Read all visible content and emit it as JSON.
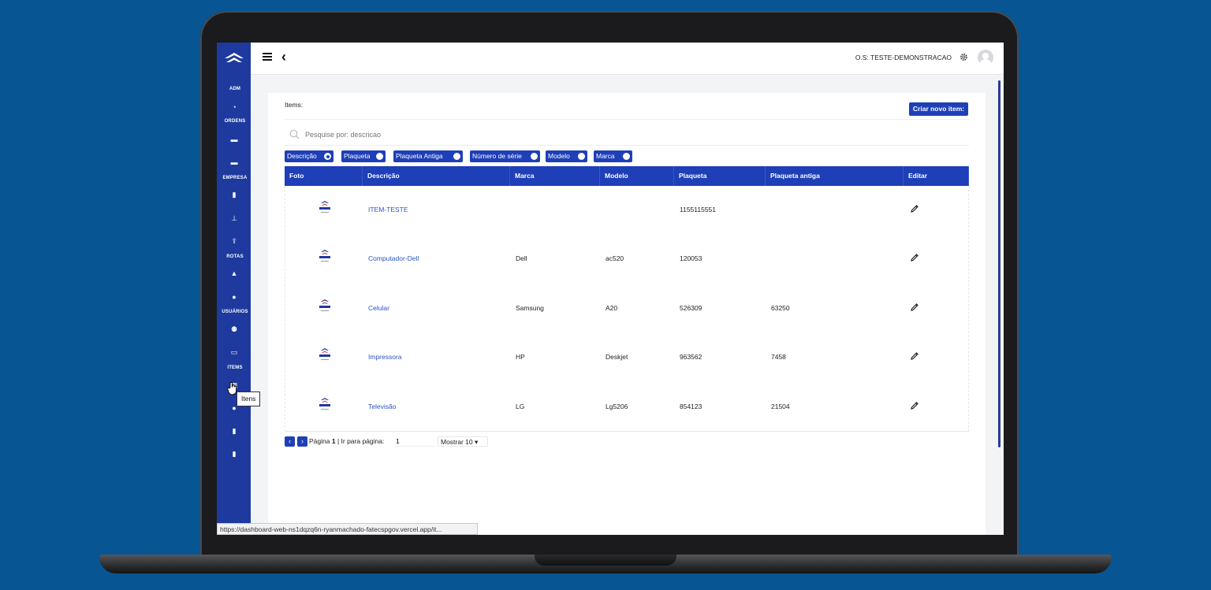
{
  "sidebar": {
    "sections": [
      "ADM",
      "ORDENS",
      "EMPRESA",
      "ROTAS",
      "USUÁRIOS",
      "ITEMS"
    ],
    "icons": [
      "dashboard-icon",
      "folder-icon",
      "folder-icon",
      "building-icon",
      "sitemap-icon",
      "upload-icon",
      "road-icon",
      "globe-icon",
      "users-icon",
      "car-icon",
      "items-icon",
      "info-icon",
      "file-icon",
      "file-icon"
    ]
  },
  "topbar": {
    "os_label": "O.S: TESTE-DEMONSTRACAO"
  },
  "page": {
    "title": "Items:",
    "create_button": "Criar novo item:",
    "search_placeholder": "Pesquise por: descricao"
  },
  "filters": [
    {
      "label": "Descrição",
      "selected": true
    },
    {
      "label": "Plaqueta",
      "selected": false
    },
    {
      "label": "Plaqueta Antiga",
      "selected": false
    },
    {
      "label": "Número de série",
      "selected": false
    },
    {
      "label": "Modelo",
      "selected": false
    },
    {
      "label": "Marca",
      "selected": false
    }
  ],
  "table": {
    "columns": [
      "Foto",
      "Descrição",
      "Marca",
      "Modelo",
      "Plaqueta",
      "Plaqueta antiga",
      "Editar"
    ],
    "rows": [
      {
        "descricao": "ITEM-TESTE",
        "marca": "",
        "modelo": "",
        "plaqueta": "1155115551",
        "plaqueta_antiga": ""
      },
      {
        "descricao": "Computador-Dell",
        "marca": "Dell",
        "modelo": "ac520",
        "plaqueta": "120053",
        "plaqueta_antiga": ""
      },
      {
        "descricao": "Celular",
        "marca": "Samsung",
        "modelo": "A20",
        "plaqueta": "526309",
        "plaqueta_antiga": "63250"
      },
      {
        "descricao": "Impressora",
        "marca": "HP",
        "modelo": "Deskjet",
        "plaqueta": "963562",
        "plaqueta_antiga": "7458"
      },
      {
        "descricao": "Televisão",
        "marca": "LG",
        "modelo": "Lg5206",
        "plaqueta": "854123",
        "plaqueta_antiga": "21504"
      }
    ]
  },
  "pagination": {
    "page_prefix": "Página",
    "page_number": "1",
    "goto_label": "| Ir para página:",
    "goto_value": "1",
    "page_size": "Mostrar 10"
  },
  "tooltip": "Itens",
  "status_url": "https://dashboard-web-ns1dqzq6n-ryanmachado-fatecspgov.vercel.app/it..."
}
